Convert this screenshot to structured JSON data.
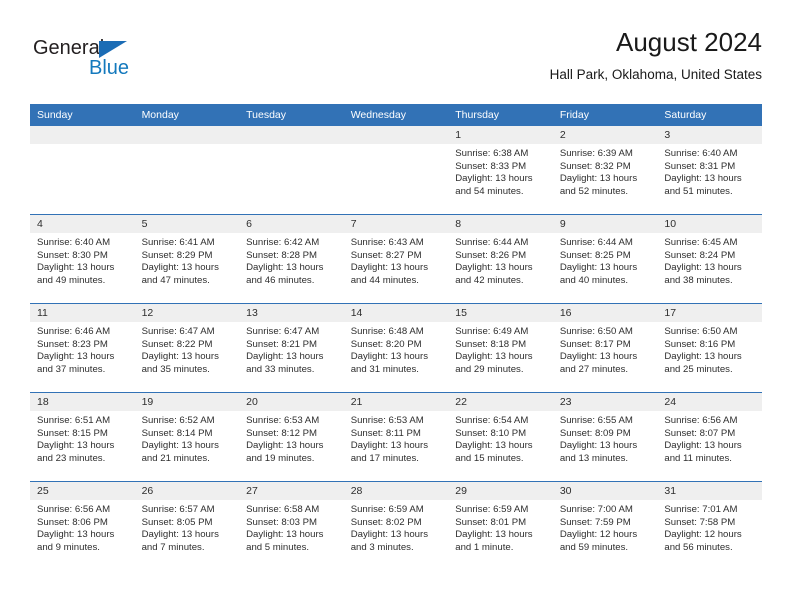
{
  "brand": {
    "name_part1": "General",
    "name_part2": "Blue",
    "triangle_icon": "triangle-icon",
    "accent_color": "#1b6cb5"
  },
  "header": {
    "title": "August 2024",
    "subtitle": "Hall Park, Oklahoma, United States"
  },
  "calendar": {
    "header_bg_color": "#3272b6",
    "daynum_bg_color": "#efefef",
    "weekday_headers": [
      "Sunday",
      "Monday",
      "Tuesday",
      "Wednesday",
      "Thursday",
      "Friday",
      "Saturday"
    ],
    "weeks": [
      [
        {
          "day": "",
          "empty": true
        },
        {
          "day": "",
          "empty": true
        },
        {
          "day": "",
          "empty": true
        },
        {
          "day": "",
          "empty": true
        },
        {
          "day": "1",
          "sunrise": "Sunrise: 6:38 AM",
          "sunset": "Sunset: 8:33 PM",
          "daylight": "Daylight: 13 hours and 54 minutes."
        },
        {
          "day": "2",
          "sunrise": "Sunrise: 6:39 AM",
          "sunset": "Sunset: 8:32 PM",
          "daylight": "Daylight: 13 hours and 52 minutes."
        },
        {
          "day": "3",
          "sunrise": "Sunrise: 6:40 AM",
          "sunset": "Sunset: 8:31 PM",
          "daylight": "Daylight: 13 hours and 51 minutes."
        }
      ],
      [
        {
          "day": "4",
          "sunrise": "Sunrise: 6:40 AM",
          "sunset": "Sunset: 8:30 PM",
          "daylight": "Daylight: 13 hours and 49 minutes."
        },
        {
          "day": "5",
          "sunrise": "Sunrise: 6:41 AM",
          "sunset": "Sunset: 8:29 PM",
          "daylight": "Daylight: 13 hours and 47 minutes."
        },
        {
          "day": "6",
          "sunrise": "Sunrise: 6:42 AM",
          "sunset": "Sunset: 8:28 PM",
          "daylight": "Daylight: 13 hours and 46 minutes."
        },
        {
          "day": "7",
          "sunrise": "Sunrise: 6:43 AM",
          "sunset": "Sunset: 8:27 PM",
          "daylight": "Daylight: 13 hours and 44 minutes."
        },
        {
          "day": "8",
          "sunrise": "Sunrise: 6:44 AM",
          "sunset": "Sunset: 8:26 PM",
          "daylight": "Daylight: 13 hours and 42 minutes."
        },
        {
          "day": "9",
          "sunrise": "Sunrise: 6:44 AM",
          "sunset": "Sunset: 8:25 PM",
          "daylight": "Daylight: 13 hours and 40 minutes."
        },
        {
          "day": "10",
          "sunrise": "Sunrise: 6:45 AM",
          "sunset": "Sunset: 8:24 PM",
          "daylight": "Daylight: 13 hours and 38 minutes."
        }
      ],
      [
        {
          "day": "11",
          "sunrise": "Sunrise: 6:46 AM",
          "sunset": "Sunset: 8:23 PM",
          "daylight": "Daylight: 13 hours and 37 minutes."
        },
        {
          "day": "12",
          "sunrise": "Sunrise: 6:47 AM",
          "sunset": "Sunset: 8:22 PM",
          "daylight": "Daylight: 13 hours and 35 minutes."
        },
        {
          "day": "13",
          "sunrise": "Sunrise: 6:47 AM",
          "sunset": "Sunset: 8:21 PM",
          "daylight": "Daylight: 13 hours and 33 minutes."
        },
        {
          "day": "14",
          "sunrise": "Sunrise: 6:48 AM",
          "sunset": "Sunset: 8:20 PM",
          "daylight": "Daylight: 13 hours and 31 minutes."
        },
        {
          "day": "15",
          "sunrise": "Sunrise: 6:49 AM",
          "sunset": "Sunset: 8:18 PM",
          "daylight": "Daylight: 13 hours and 29 minutes."
        },
        {
          "day": "16",
          "sunrise": "Sunrise: 6:50 AM",
          "sunset": "Sunset: 8:17 PM",
          "daylight": "Daylight: 13 hours and 27 minutes."
        },
        {
          "day": "17",
          "sunrise": "Sunrise: 6:50 AM",
          "sunset": "Sunset: 8:16 PM",
          "daylight": "Daylight: 13 hours and 25 minutes."
        }
      ],
      [
        {
          "day": "18",
          "sunrise": "Sunrise: 6:51 AM",
          "sunset": "Sunset: 8:15 PM",
          "daylight": "Daylight: 13 hours and 23 minutes."
        },
        {
          "day": "19",
          "sunrise": "Sunrise: 6:52 AM",
          "sunset": "Sunset: 8:14 PM",
          "daylight": "Daylight: 13 hours and 21 minutes."
        },
        {
          "day": "20",
          "sunrise": "Sunrise: 6:53 AM",
          "sunset": "Sunset: 8:12 PM",
          "daylight": "Daylight: 13 hours and 19 minutes."
        },
        {
          "day": "21",
          "sunrise": "Sunrise: 6:53 AM",
          "sunset": "Sunset: 8:11 PM",
          "daylight": "Daylight: 13 hours and 17 minutes."
        },
        {
          "day": "22",
          "sunrise": "Sunrise: 6:54 AM",
          "sunset": "Sunset: 8:10 PM",
          "daylight": "Daylight: 13 hours and 15 minutes."
        },
        {
          "day": "23",
          "sunrise": "Sunrise: 6:55 AM",
          "sunset": "Sunset: 8:09 PM",
          "daylight": "Daylight: 13 hours and 13 minutes."
        },
        {
          "day": "24",
          "sunrise": "Sunrise: 6:56 AM",
          "sunset": "Sunset: 8:07 PM",
          "daylight": "Daylight: 13 hours and 11 minutes."
        }
      ],
      [
        {
          "day": "25",
          "sunrise": "Sunrise: 6:56 AM",
          "sunset": "Sunset: 8:06 PM",
          "daylight": "Daylight: 13 hours and 9 minutes."
        },
        {
          "day": "26",
          "sunrise": "Sunrise: 6:57 AM",
          "sunset": "Sunset: 8:05 PM",
          "daylight": "Daylight: 13 hours and 7 minutes."
        },
        {
          "day": "27",
          "sunrise": "Sunrise: 6:58 AM",
          "sunset": "Sunset: 8:03 PM",
          "daylight": "Daylight: 13 hours and 5 minutes."
        },
        {
          "day": "28",
          "sunrise": "Sunrise: 6:59 AM",
          "sunset": "Sunset: 8:02 PM",
          "daylight": "Daylight: 13 hours and 3 minutes."
        },
        {
          "day": "29",
          "sunrise": "Sunrise: 6:59 AM",
          "sunset": "Sunset: 8:01 PM",
          "daylight": "Daylight: 13 hours and 1 minute."
        },
        {
          "day": "30",
          "sunrise": "Sunrise: 7:00 AM",
          "sunset": "Sunset: 7:59 PM",
          "daylight": "Daylight: 12 hours and 59 minutes."
        },
        {
          "day": "31",
          "sunrise": "Sunrise: 7:01 AM",
          "sunset": "Sunset: 7:58 PM",
          "daylight": "Daylight: 12 hours and 56 minutes."
        }
      ]
    ]
  }
}
